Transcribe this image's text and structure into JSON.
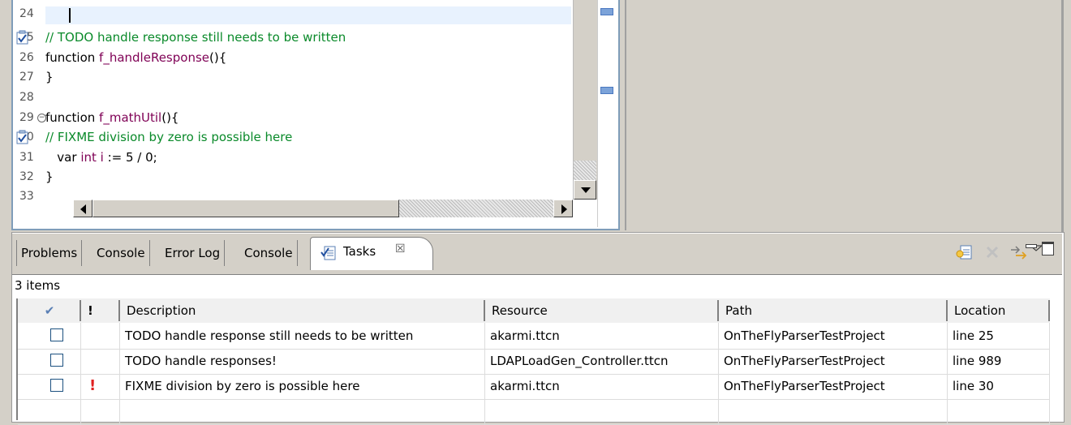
{
  "editor": {
    "lines": [
      {
        "n": "24",
        "parts": [],
        "task": false,
        "fold": false
      },
      {
        "n": "25",
        "parts": [
          {
            "t": "// TODO handle response still needs to be written",
            "c": "cm"
          }
        ],
        "task": true,
        "fold": false
      },
      {
        "n": "26",
        "parts": [
          {
            "t": "function ",
            "c": "kw"
          },
          {
            "t": "f_handleResponse",
            "c": "fn"
          },
          {
            "t": "(){",
            "c": "kw"
          }
        ],
        "task": false,
        "fold": false
      },
      {
        "n": "27",
        "parts": [
          {
            "t": "}",
            "c": "kw"
          }
        ],
        "task": false,
        "fold": false
      },
      {
        "n": "28",
        "parts": [],
        "task": false,
        "fold": false
      },
      {
        "n": "29",
        "parts": [
          {
            "t": "function ",
            "c": "kw"
          },
          {
            "t": "f_mathUtil",
            "c": "fn"
          },
          {
            "t": "(){",
            "c": "kw"
          }
        ],
        "task": false,
        "fold": true
      },
      {
        "n": "30",
        "parts": [
          {
            "t": "// FIXME division by zero is possible here",
            "c": "cm"
          }
        ],
        "task": true,
        "fold": false
      },
      {
        "n": "31",
        "parts": [
          {
            "t": "   var ",
            "c": "kw"
          },
          {
            "t": "int",
            "c": "ty"
          },
          {
            "t": " i",
            "c": "fn"
          },
          {
            "t": " := 5 / 0;",
            "c": "kw"
          }
        ],
        "task": false,
        "fold": false
      },
      {
        "n": "32",
        "parts": [
          {
            "t": "}",
            "c": "kw"
          }
        ],
        "task": false,
        "fold": false
      },
      {
        "n": "33",
        "parts": [],
        "task": false,
        "fold": false
      }
    ]
  },
  "tabs": [
    "Problems",
    "Console",
    "Error Log",
    "Console"
  ],
  "active_tab": {
    "label": "Tasks",
    "close": "☒"
  },
  "toolbar": {
    "icons": [
      "new-task-icon",
      "delete-task-icon",
      "link-with-editor-icon",
      "view-menu-icon",
      "minimize-icon",
      "maximize-icon"
    ]
  },
  "tasks": {
    "count_label": "3 items",
    "columns": {
      "done": "✔",
      "priority": "!",
      "description": "Description",
      "resource": "Resource",
      "path": "Path",
      "location": "Location"
    },
    "rows": [
      {
        "done": false,
        "priority": "",
        "description": "TODO handle response still needs to be written",
        "resource": "akarmi.ttcn",
        "path": "OnTheFlyParserTestProject",
        "location": "line 25"
      },
      {
        "done": false,
        "priority": "",
        "description": "TODO handle responses!",
        "resource": "LDAPLoadGen_Controller.ttcn",
        "path": "OnTheFlyParserTestProject",
        "location": "line 989"
      },
      {
        "done": false,
        "priority": "!",
        "description": "FIXME division by zero is possible here",
        "resource": "akarmi.ttcn",
        "path": "OnTheFlyParserTestProject",
        "location": "line 30"
      }
    ]
  },
  "colors": {
    "comment": "#0a8a2a",
    "keyword": "#7f0055",
    "current_line": "#e8f2fe",
    "high_priority": "#e02020"
  }
}
